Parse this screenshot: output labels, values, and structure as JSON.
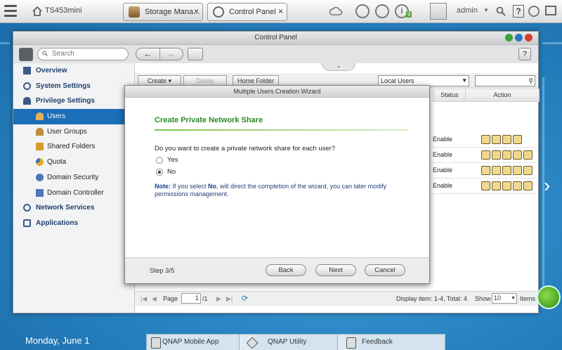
{
  "taskbar": {
    "device_name": "TS453mini",
    "tabs": [
      {
        "label": "Storage Mana...",
        "close": "×"
      },
      {
        "label": "Control Panel",
        "close": "×"
      }
    ],
    "notification_count": "9",
    "user": "admin",
    "help": "?"
  },
  "window": {
    "title": "Control Panel",
    "search_placeholder": "Search",
    "back": "←",
    "forward": "→",
    "help": "?"
  },
  "sidebar": {
    "items": [
      {
        "label": "Overview",
        "icon": "overview-icon"
      },
      {
        "label": "System Settings",
        "icon": "gear-icon"
      },
      {
        "label": "Privilege Settings",
        "icon": "user-icon"
      },
      {
        "label": "Users",
        "icon": "user-icon",
        "active": true
      },
      {
        "label": "User Groups",
        "icon": "group-icon"
      },
      {
        "label": "Shared Folders",
        "icon": "folder-icon"
      },
      {
        "label": "Quota",
        "icon": "pie-icon"
      },
      {
        "label": "Domain Security",
        "icon": "domain-icon"
      },
      {
        "label": "Domain Controller",
        "icon": "server-icon"
      },
      {
        "label": "Network Services",
        "icon": "network-icon"
      },
      {
        "label": "Applications",
        "icon": "apps-icon"
      }
    ]
  },
  "users_panel": {
    "create": "Create",
    "delete": "Delete",
    "home_folder": "Home Folder",
    "user_scope": "Local Users",
    "col_status": "Status",
    "col_action": "Action",
    "rows": [
      {
        "status": "Enable"
      },
      {
        "status": "Enable"
      },
      {
        "status": "Enable"
      },
      {
        "status": "Enable"
      }
    ],
    "pager": {
      "page_label": "Page",
      "page": "1",
      "total_pages": "/1",
      "display": "Display item: 1-4, Total: 4",
      "show": "Show",
      "per_page": "10",
      "items": "Items"
    }
  },
  "wizard": {
    "title": "Multiple Users Creation Wizard",
    "heading": "Create Private Network Share",
    "question": "Do you want to create a private network share for each user?",
    "options": [
      {
        "label": "Yes",
        "checked": false
      },
      {
        "label": "No",
        "checked": true
      }
    ],
    "note_label": "Note:",
    "note_text": " If you select ",
    "note_no": "No",
    "note_rest": ", will direct the completion of the wizard, you can later modify permissions management.",
    "step": "Step 3/5",
    "back": "Back",
    "next": "Next",
    "cancel": "Cancel"
  },
  "desktop": {
    "date": "Monday, June 1",
    "dock": [
      {
        "label": "QNAP Mobile App"
      },
      {
        "label": "QNAP Utility"
      },
      {
        "label": "Feedback"
      }
    ]
  },
  "colors": {
    "accent": "#1b6fb8",
    "heading_green": "#2b8a2b",
    "note_blue": "#24427a"
  }
}
